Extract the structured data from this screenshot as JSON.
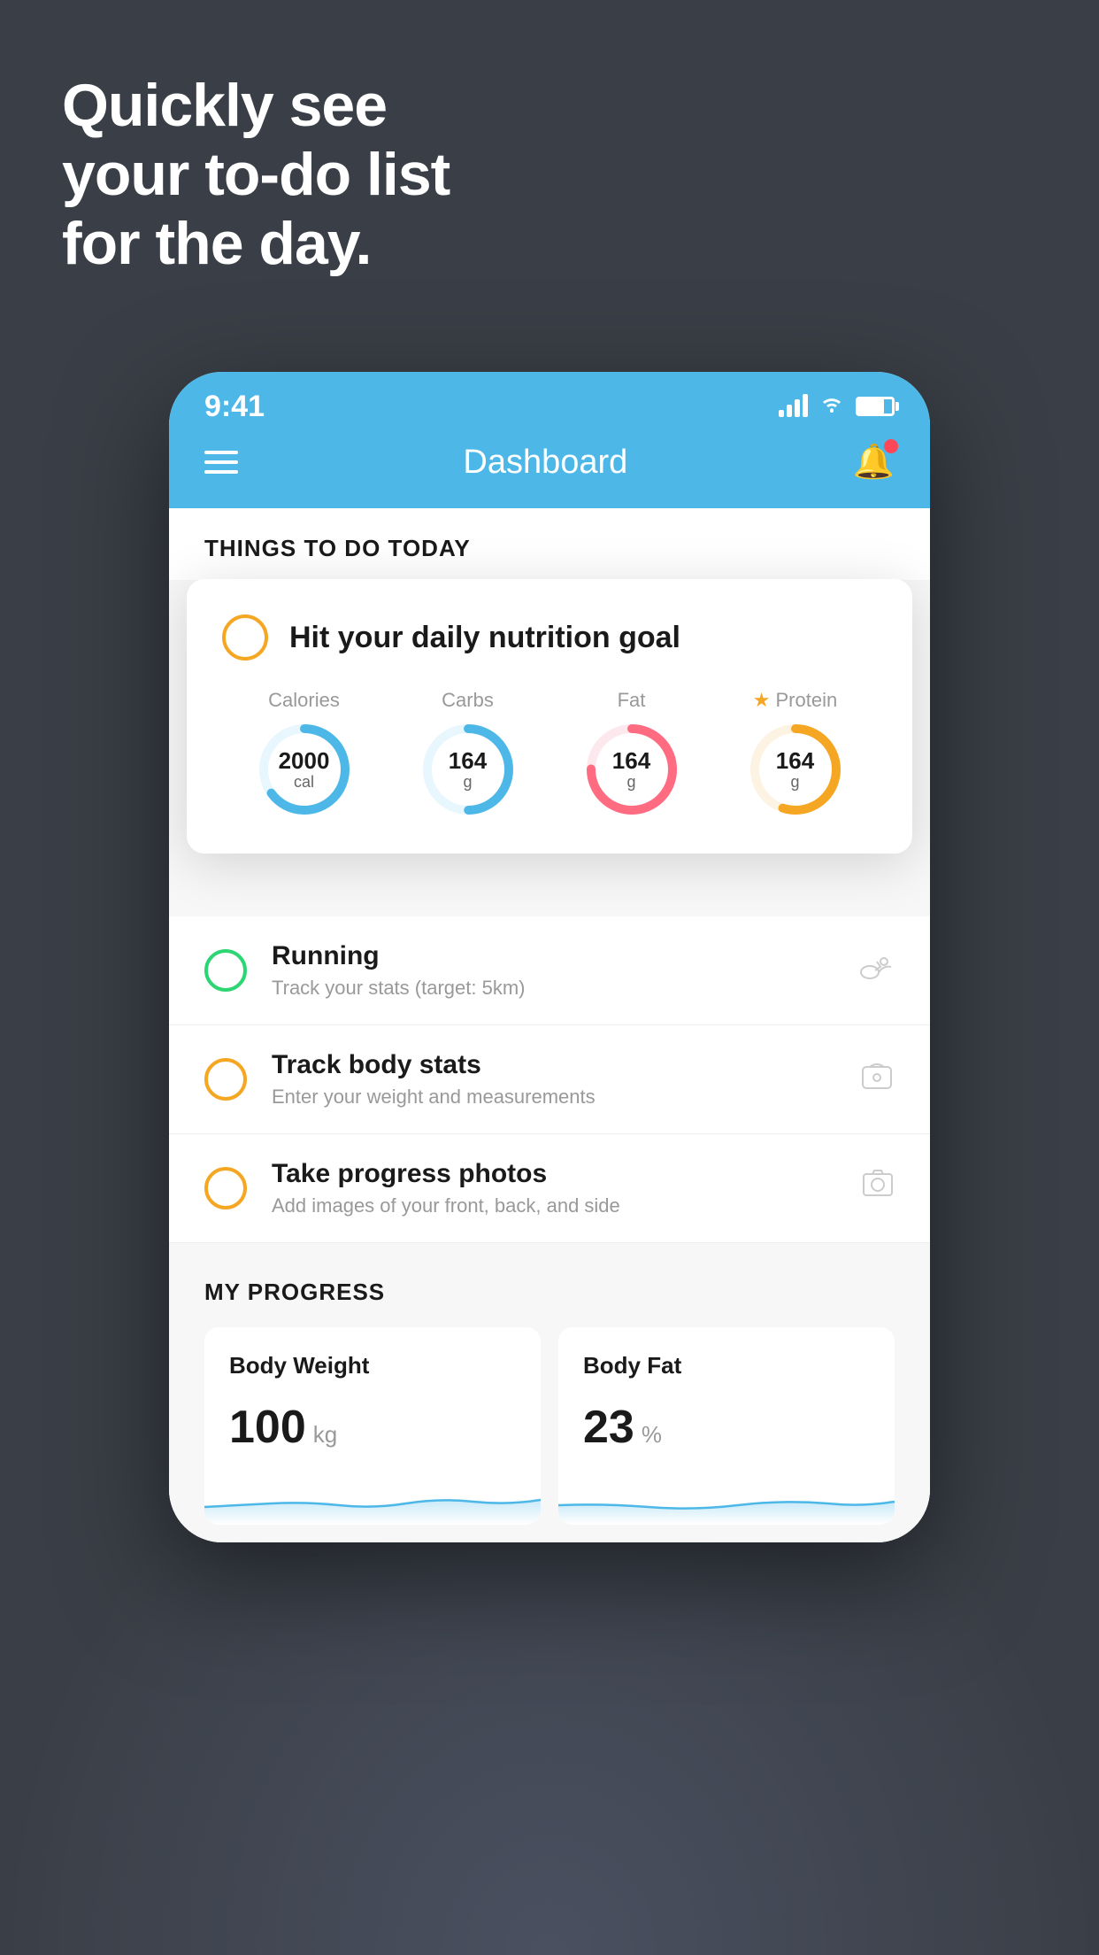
{
  "hero": {
    "title": "Quickly see\nyour to-do list\nfor the day."
  },
  "phone": {
    "statusBar": {
      "time": "9:41"
    },
    "navBar": {
      "title": "Dashboard"
    },
    "sectionHeader": "THINGS TO DO TODAY",
    "floatingCard": {
      "title": "Hit your daily nutrition goal",
      "nutrition": [
        {
          "label": "Calories",
          "value": "2000",
          "unit": "cal",
          "color": "#4db8e8",
          "highlight": false,
          "percent": 65
        },
        {
          "label": "Carbs",
          "value": "164",
          "unit": "g",
          "color": "#4db8e8",
          "highlight": false,
          "percent": 50
        },
        {
          "label": "Fat",
          "value": "164",
          "unit": "g",
          "color": "#ff6b81",
          "highlight": false,
          "percent": 75
        },
        {
          "label": "Protein",
          "value": "164",
          "unit": "g",
          "color": "#f5a623",
          "highlight": true,
          "percent": 55
        }
      ]
    },
    "todoItems": [
      {
        "title": "Running",
        "subtitle": "Track your stats (target: 5km)",
        "circleColor": "green",
        "icon": "👟"
      },
      {
        "title": "Track body stats",
        "subtitle": "Enter your weight and measurements",
        "circleColor": "yellow",
        "icon": "⚖️"
      },
      {
        "title": "Take progress photos",
        "subtitle": "Add images of your front, back, and side",
        "circleColor": "yellow",
        "icon": "🖼️"
      }
    ],
    "progress": {
      "header": "MY PROGRESS",
      "cards": [
        {
          "title": "Body Weight",
          "value": "100",
          "unit": "kg"
        },
        {
          "title": "Body Fat",
          "value": "23",
          "unit": "%"
        }
      ]
    }
  }
}
